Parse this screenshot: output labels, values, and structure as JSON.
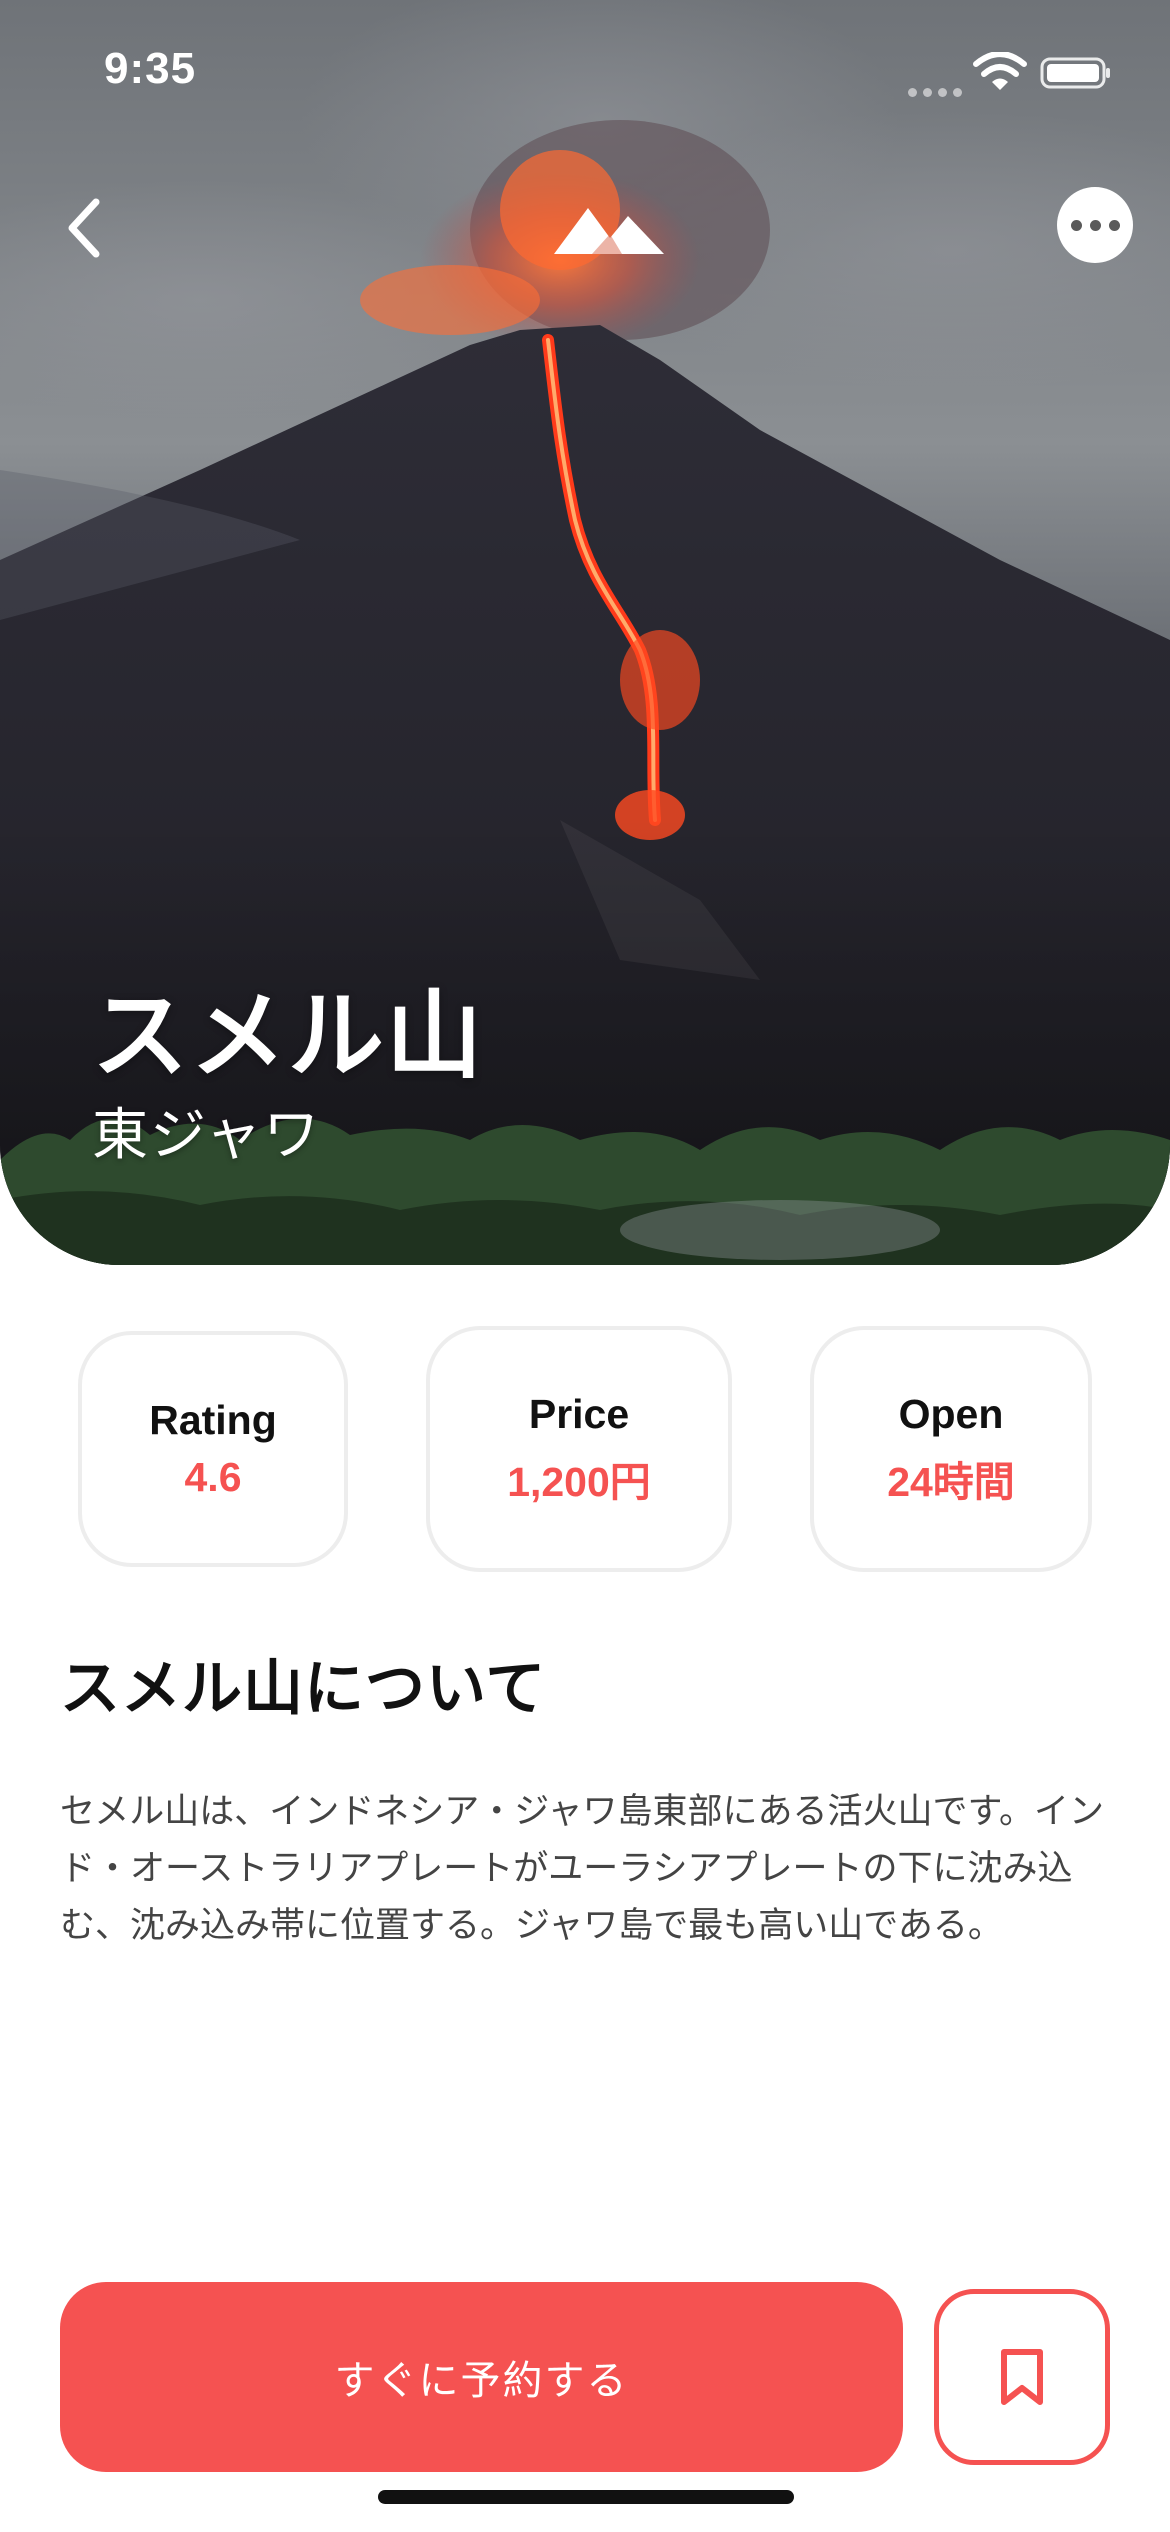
{
  "status_bar": {
    "time": "9:35"
  },
  "nav": {
    "back_icon": "chevron-left-icon",
    "logo_icon": "mountain-icon",
    "more_icon": "more-icon"
  },
  "hero": {
    "title": "スメル山",
    "subtitle": "東ジャワ"
  },
  "stats": [
    {
      "label": "Rating",
      "value": "4.6"
    },
    {
      "label": "Price",
      "value": "1,200円"
    },
    {
      "label": "Open",
      "value": "24時間"
    }
  ],
  "about": {
    "title": "スメル山について",
    "body": "セメル山は、インドネシア・ジャワ島東部にある活火山です。インド・オーストラリアプレートがユーラシアプレートの下に沈み込む、沈み込み帯に位置する。ジャワ島で最も高い山である。"
  },
  "actions": {
    "book_label": "すぐに予約する",
    "bookmark_icon": "bookmark-icon"
  },
  "colors": {
    "accent": "#f55251",
    "card_border": "#ededed"
  }
}
